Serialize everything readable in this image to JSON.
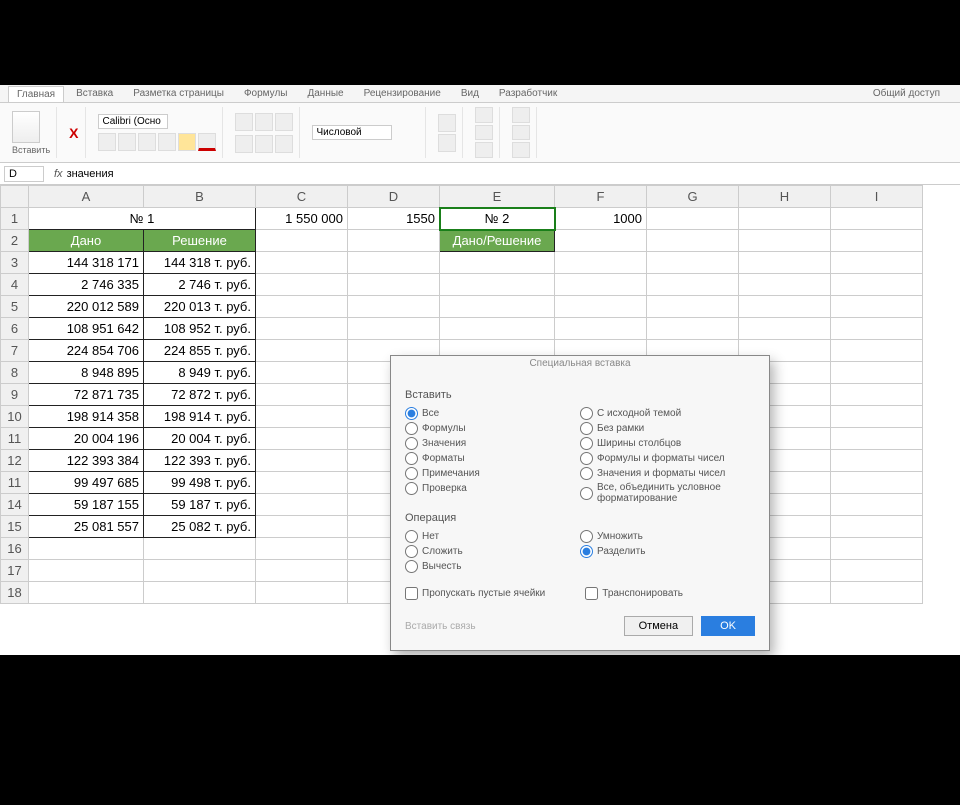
{
  "ribbon": {
    "tabs": [
      "Главная",
      "Вставка",
      "Разметка страницы",
      "Формулы",
      "Данные",
      "Рецензирование",
      "Вид",
      "Разработчик"
    ],
    "right_label": "Общий доступ",
    "font_name": "Calibri (Осно",
    "paste_label": "Вставить",
    "cut_symbol": "X"
  },
  "formula_bar": {
    "name_box": "D",
    "fx": "fx",
    "formula": "значения"
  },
  "columns": [
    "A",
    "B",
    "C",
    "D",
    "E",
    "F",
    "G",
    "H",
    "I"
  ],
  "rows": [
    "1",
    "2",
    "3",
    "4",
    "5",
    "6",
    "7",
    "8",
    "9",
    "10",
    "11",
    "12",
    "11",
    "14",
    "15",
    "16",
    "17",
    "18"
  ],
  "cells": {
    "r1": {
      "AB": "№ 1",
      "C": "1 550 000",
      "D": "1550",
      "E": "№ 2",
      "F": "1000"
    },
    "r2": {
      "A": "Дано",
      "B": "Решение",
      "E": "Дано/Решение"
    },
    "data": [
      {
        "A": "144 318 171",
        "B": "144 318 т. руб."
      },
      {
        "A": "2 746 335",
        "B": "2 746 т. руб."
      },
      {
        "A": "220 012 589",
        "B": "220 013 т. руб."
      },
      {
        "A": "108 951 642",
        "B": "108 952 т. руб."
      },
      {
        "A": "224 854 706",
        "B": "224 855 т. руб."
      },
      {
        "A": "8 948 895",
        "B": "8 949 т. руб."
      },
      {
        "A": "72 871 735",
        "B": "72 872 т. руб."
      },
      {
        "A": "198 914 358",
        "B": "198 914 т. руб."
      },
      {
        "A": "20 004 196",
        "B": "20 004 т. руб."
      },
      {
        "A": "122 393 384",
        "B": "122 393 т. руб."
      },
      {
        "A": "99 497 685",
        "B": "99 498 т. руб."
      },
      {
        "A": "59 187 155",
        "B": "59 187 т. руб."
      },
      {
        "A": "25 081 557",
        "B": "25 082 т. руб."
      }
    ]
  },
  "dialog": {
    "title": "Специальная вставка",
    "section_insert": "Вставить",
    "insert_left": [
      "Все",
      "Формулы",
      "Значения",
      "Форматы",
      "Примечания",
      "Проверка"
    ],
    "insert_right": [
      "С исходной темой",
      "Без рамки",
      "Ширины столбцов",
      "Формулы и форматы чисел",
      "Значения и форматы чисел",
      "Все, объединить условное форматирование"
    ],
    "section_op": "Операция",
    "op_left": [
      "Нет",
      "Сложить",
      "Вычесть"
    ],
    "op_right": [
      "Умножить",
      "Разделить"
    ],
    "skip_blanks": "Пропускать пустые ячейки",
    "transpose": "Транспонировать",
    "paste_link": "Вставить связь",
    "cancel": "Отмена",
    "ok": "OK"
  }
}
